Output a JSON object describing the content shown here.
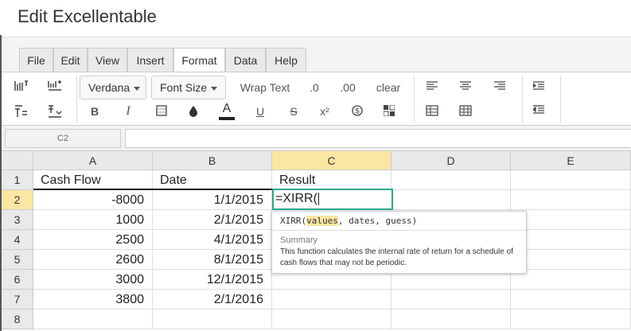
{
  "app": {
    "title": "Edit Excellentable"
  },
  "menu": {
    "tabs": [
      {
        "label": "File"
      },
      {
        "label": "Edit"
      },
      {
        "label": "View"
      },
      {
        "label": "Insert"
      },
      {
        "label": "Format",
        "active": true
      },
      {
        "label": "Data"
      },
      {
        "label": "Help"
      }
    ]
  },
  "toolbar": {
    "font_family": "Verdana",
    "font_size": "Font Size",
    "wrap_text": "Wrap Text",
    "decimal_0": ".0",
    "decimal_00": ".00",
    "clear": "clear",
    "bold": "B",
    "italic": "I",
    "font_color": "A",
    "underline": "U",
    "strike": "S",
    "superscript": "x²"
  },
  "formula_bar": {
    "cell_ref": "C2",
    "content": ""
  },
  "grid": {
    "columns": [
      "A",
      "B",
      "C",
      "D",
      "E"
    ],
    "rows": [
      "1",
      "2",
      "3",
      "4",
      "5",
      "6",
      "7",
      "8"
    ],
    "cells": {
      "A1": "Cash Flow",
      "B1": "Date",
      "C1": "Result",
      "A2": "-8000",
      "B2": "1/1/2015",
      "A3": "1000",
      "B3": "2/1/2015",
      "A4": "2500",
      "B4": "4/1/2015",
      "A5": "2600",
      "B5": "8/1/2015",
      "A6": "3000",
      "B6": "12/1/2015",
      "A7": "3800",
      "B7": "2/1/2016"
    },
    "active_cell_value": "=XIRR("
  },
  "tooltip": {
    "fn": "XIRR(",
    "arg1": "values",
    "rest": ", dates, guess)",
    "summary_label": "Summary",
    "description": "This function calculates the internal rate of return for a schedule of cash flows that may not be periodic."
  },
  "colors": {
    "accent": "#2aa88d",
    "selected_header": "#fbe6a2"
  }
}
